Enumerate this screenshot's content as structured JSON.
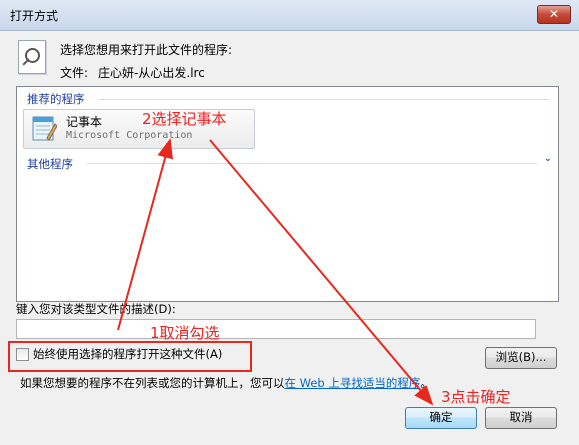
{
  "window": {
    "title": "打开方式",
    "close_symbol": "✕"
  },
  "header": {
    "prompt": "选择您想用来打开此文件的程序:",
    "file_label": "文件:",
    "file_name": "庄心妍-从心出发.lrc"
  },
  "list": {
    "recommended_label": "推荐的程序",
    "program": {
      "name": "记事本",
      "vendor": "Microsoft Corporation"
    },
    "other_label": "其他程序",
    "expand_symbol": "⌄"
  },
  "description": {
    "label": "键入您对该类型文件的描述(D):",
    "value": ""
  },
  "always_use": {
    "label": "始终使用选择的程序打开这种文件(A)",
    "checked": false
  },
  "browse_button": "浏览(B)...",
  "help": {
    "before": "如果您想要的程序不在列表或您的计算机上，您可以",
    "link": "在 Web 上寻找适当的程序",
    "after": "。"
  },
  "buttons": {
    "ok": "确定",
    "cancel": "取消"
  },
  "annotations": {
    "step1": "1取消勾选",
    "step2": "2选择记事本",
    "step3": "3点击确定",
    "color": "#e8281e"
  }
}
